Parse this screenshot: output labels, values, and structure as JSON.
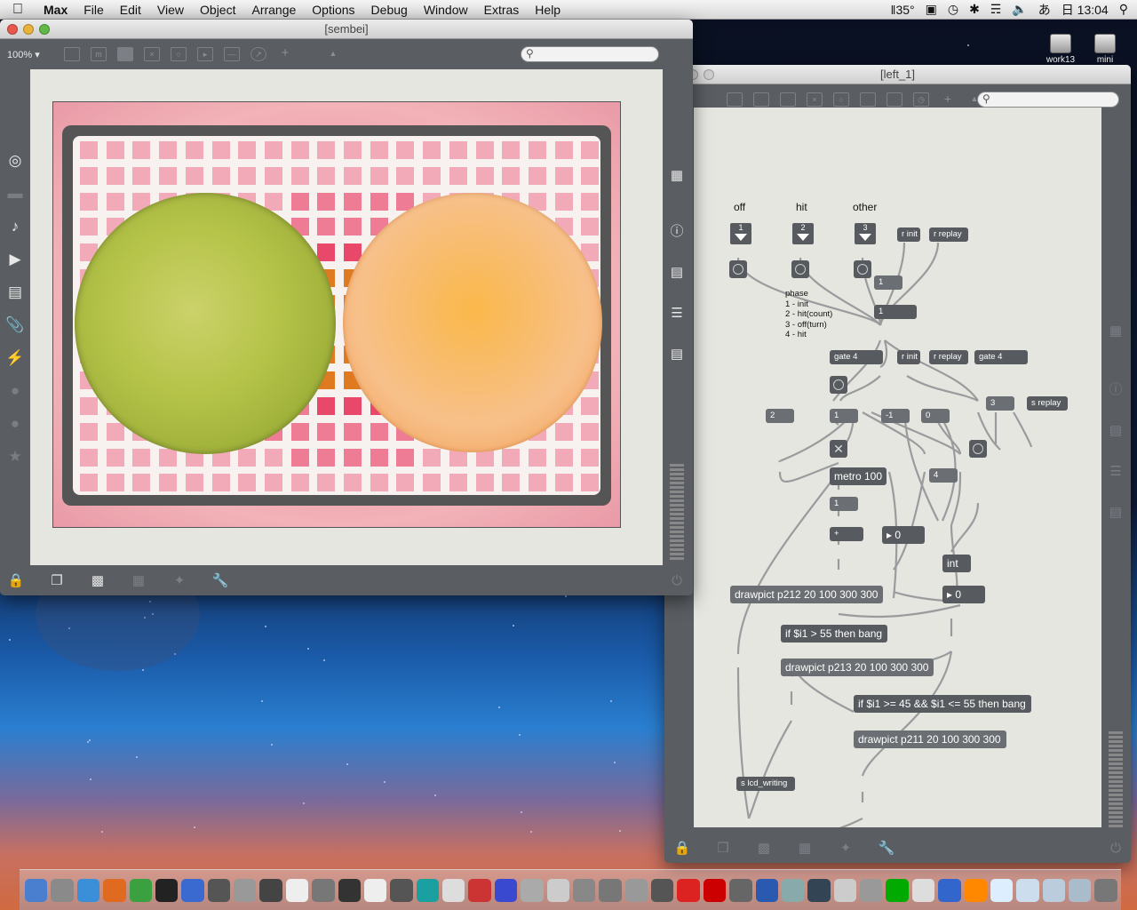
{
  "menubar": {
    "app_name": "Max",
    "items": [
      "File",
      "Edit",
      "View",
      "Object",
      "Arrange",
      "Options",
      "Debug",
      "Window",
      "Extras",
      "Help"
    ],
    "temperature": "35°",
    "ime": "あ",
    "clock": "日 13:04"
  },
  "desktop": {
    "icons": [
      {
        "label": "work13"
      },
      {
        "label": "mini"
      }
    ]
  },
  "sembei_window": {
    "title": "[sembei]",
    "zoom": "100%",
    "search_value": ""
  },
  "left_window": {
    "title": "[left_1]",
    "search_value": ""
  },
  "patcher": {
    "inlet_labels": [
      "off",
      "hit",
      "other"
    ],
    "inlet_numbers": [
      "1",
      "2",
      "3"
    ],
    "comment": "phase\n1 - init\n2 - hit(count)\n3 - off(turn)\n4 - hit",
    "objects": {
      "r_init_1": "r init",
      "r_replay_1": "r replay",
      "num_1": "1",
      "num_phase": "1",
      "gate_a": "gate 4",
      "r_init_2": "r init",
      "r_replay_2": "r replay",
      "gate_b": "gate 4",
      "msg_2": "2",
      "msg_1a": "1",
      "msg_neg1": "-1",
      "msg_0": "0",
      "msg_3": "3",
      "s_replay": "s replay",
      "metro": "metro 100",
      "msg_4": "4",
      "msg_1b": "1",
      "plus": "+",
      "num_0a": "0",
      "int": "int",
      "num_0b": "0",
      "drawpict_212": "drawpict p212 20 100 300 300",
      "if_55": "if $i1 > 55 then bang",
      "drawpict_213": "drawpict p213 20 100 300 300",
      "if_45_55": "if $i1 >= 45 && $i1 <= 55 then bang",
      "drawpict_211": "drawpict p211 20 100 300 300",
      "s_lcd": "s lcd_writing"
    }
  },
  "colors": {
    "window_chrome": "#5a5e63",
    "canvas": "#e6e6e1",
    "object": "#575a5e",
    "wire": "#9a9b9d",
    "lcd_pink": "#f04a6a",
    "cracker_green": "#b6c44a",
    "cracker_orange": "#f8bc6a"
  },
  "icons": {
    "sembei_toolbar": [
      "patcher-window-icon",
      "comment-icon",
      "message-icon",
      "toggle-icon",
      "bang-icon",
      "number-icon",
      "slider-icon",
      "dial-icon",
      "add-object-icon",
      "paint-bucket-icon"
    ],
    "sembei_left_sidebar": [
      "circle-target-icon",
      "panel-icon",
      "note-icon",
      "sequencer-icon",
      "image-icon",
      "paperclip-icon",
      "plug-icon",
      "v-icon",
      "b-icon",
      "star-icon"
    ],
    "sembei_right_sidebar": [
      "keyboard-grid-icon",
      "info-icon",
      "book-icon",
      "list-icon",
      "reference-icon",
      "meter-icon",
      "power-icon"
    ],
    "bottom_toolbar": [
      "lock-icon",
      "presentation-icon",
      "comment-bubble-icon",
      "grid-icon",
      "snap-icon",
      "wrench-icon"
    ]
  },
  "dock": {
    "items": [
      "finder",
      "system-prefs",
      "safari",
      "firefox",
      "bbedit",
      "terminal",
      "vc",
      "app7",
      "app8",
      "app9",
      "pd",
      "app11",
      "app12",
      "app13",
      "app14",
      "arduino",
      "app16",
      "app17",
      "app18",
      "app19",
      "app20",
      "app21",
      "app22",
      "app23",
      "app24",
      "itunes",
      "flash",
      "app27",
      "app28",
      "app29",
      "app30",
      "app31",
      "app32",
      "app33",
      "app34",
      "app35",
      "vlc",
      "app37",
      "app38",
      "app39",
      "app40",
      "trash"
    ]
  }
}
